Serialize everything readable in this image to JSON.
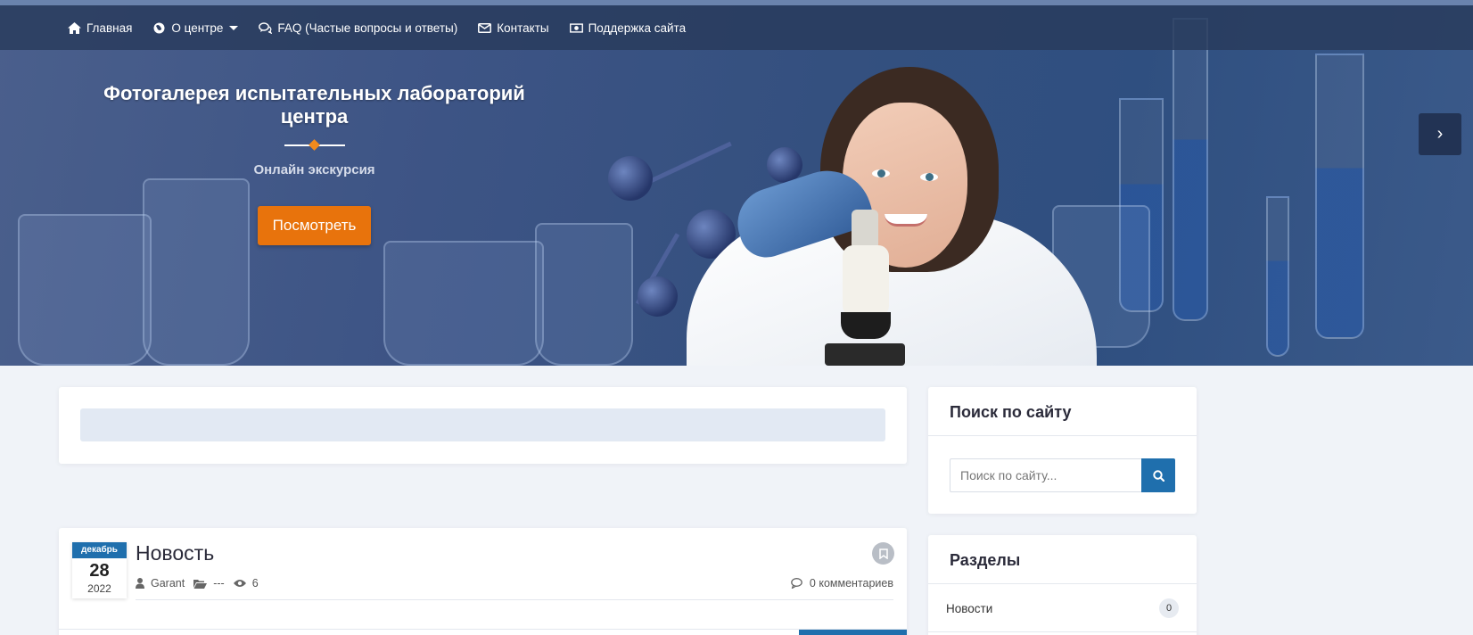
{
  "nav": {
    "items": [
      {
        "label": "Главная",
        "icon": "home-icon"
      },
      {
        "label": "О центре",
        "icon": "globe-icon",
        "has_dropdown": true
      },
      {
        "label": "FAQ (Частые вопросы и ответы)",
        "icon": "comments-icon"
      },
      {
        "label": "Контакты",
        "icon": "envelope-icon"
      },
      {
        "label": "Поддержка сайта",
        "icon": "money-icon"
      }
    ]
  },
  "hero": {
    "title": "Фотогалерея испытательных лабораторий центра",
    "subtitle": "Онлайн экскурсия",
    "button_label": "Посмотреть",
    "next_label": "›",
    "accent": "#e8730c"
  },
  "news": {
    "date": {
      "month": "декабрь",
      "day": "28",
      "year": "2022"
    },
    "title": "Новость",
    "author": "Garant",
    "category": "---",
    "views": "6",
    "comments": "0 комментариев"
  },
  "sidebar": {
    "search": {
      "title": "Поиск по сайту",
      "placeholder": "Поиск по сайту..."
    },
    "sections": {
      "title": "Разделы",
      "items": [
        {
          "label": "Новости",
          "count": "0"
        }
      ]
    }
  },
  "colors": {
    "primary": "#1f6fad",
    "nav_bg": "#283a5c",
    "page_bg": "#f0f3f8"
  }
}
